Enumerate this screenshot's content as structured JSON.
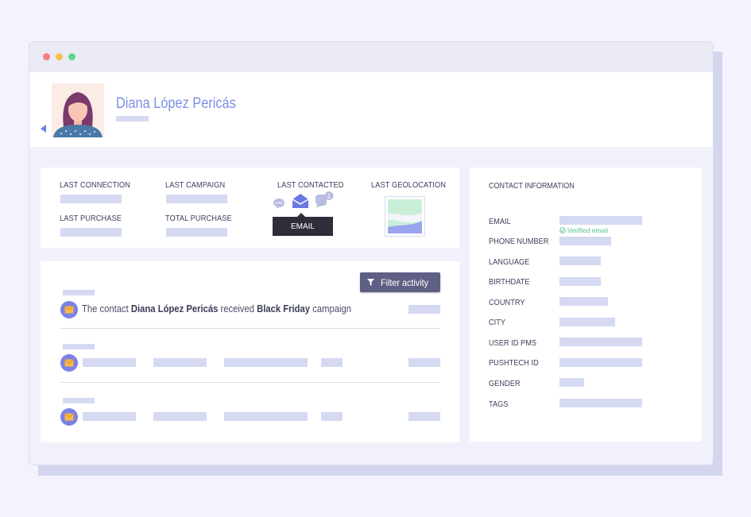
{
  "window": {
    "dots": [
      "#f87c83",
      "#f8c14f",
      "#5fd68f"
    ]
  },
  "profile": {
    "name": "Diana López Pericás"
  },
  "stats": {
    "last_connection": "LAST CONNECTION",
    "last_campaign": "LAST CAMPAIGN",
    "last_contacted": "LAST CONTACTED",
    "last_geolocation": "LAST GEOLOCATION",
    "last_purchase": "LAST PURCHASE",
    "total_purchase": "TOTAL PURCHASE",
    "tooltip": "EMAIL",
    "notification_count": "1"
  },
  "activity": {
    "filter_label": "Filter activity",
    "item1": {
      "prefix": "The contact",
      "name": "Diana López Pericás",
      "middle": "received",
      "campaign": "Black Friday",
      "suffix": "campaign"
    }
  },
  "contact": {
    "title": "CONTACT INFORMATION",
    "verified": "Verified email",
    "fields": [
      "EMAIL",
      "PHONE NUMBER",
      "LANGUAGE",
      "BIRTHDATE",
      "COUNTRY",
      "CITY",
      "USER ID PMS",
      "PUSHTECH ID",
      "GENDER",
      "TAGS"
    ]
  },
  "colors": {
    "accent": "#7d8fe9",
    "placeholder": "#d5d9f2",
    "button": "#5f5f85",
    "verified": "#52c48a"
  }
}
